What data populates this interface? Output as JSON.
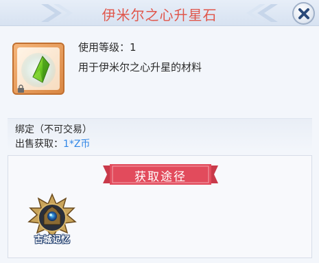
{
  "header": {
    "title": "伊米尔之心升星石",
    "close_icon": "close-icon"
  },
  "item": {
    "icon": "green-star-gem-icon",
    "frame_color": "#d98743",
    "use_level_label": "使用等级：1",
    "description": "用于伊米尔之心升星的材料"
  },
  "info": {
    "bind_text": "绑定（不可交易）",
    "sell_label": "出售获取：",
    "sell_value": "1*Z币"
  },
  "source": {
    "banner_text": "获取途径",
    "items": [
      {
        "label": "古城记忆",
        "icon": "ancient-city-icon"
      }
    ]
  },
  "colors": {
    "title": "#e0564b",
    "banner": "#e24b5c",
    "sell_value": "#2f86e6"
  }
}
